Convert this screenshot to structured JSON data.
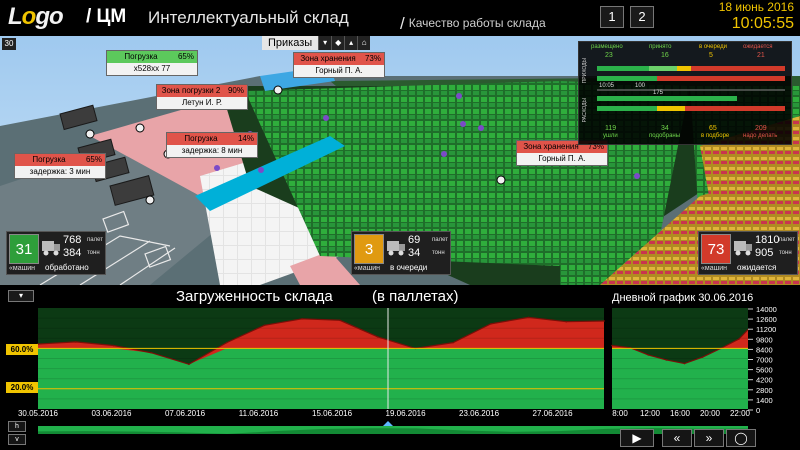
{
  "header": {
    "logo_text_left": "L",
    "logo_text_o": "o",
    "logo_text_right": "go",
    "app_title": "/ ЦМ",
    "title": "Интеллектуальный склад",
    "subtitle_slash": "/",
    "subtitle": "Качество работы склада",
    "pages": [
      "1",
      "2"
    ],
    "date": "18 июнь 2016",
    "time": "10:05:55"
  },
  "scene": {
    "fps": "30",
    "orders_label": "Приказы",
    "orders_buttons": [
      "▾",
      "◆",
      "▴",
      "⌂"
    ],
    "tags": [
      {
        "title": "Погрузка",
        "value": "65%",
        "line": "x528xx 77",
        "color": "green"
      },
      {
        "title": "Зона погрузки 2",
        "value": "90%",
        "line": "Летун И. Р.",
        "color": "red"
      },
      {
        "title": "Погрузка",
        "value": "14%",
        "line": "задержка: 8 мин",
        "color": "red"
      },
      {
        "title": "Погрузка",
        "value": "65%",
        "line": "задержка: 3 мин",
        "color": "red"
      },
      {
        "title": "Зона хранения",
        "value": "73%",
        "line": "Горный П. А.",
        "color": "red"
      },
      {
        "title": "Зона хранения",
        "value": "73%",
        "line": "Горный П. А.",
        "color": "red"
      }
    ],
    "stats": {
      "headers": [
        "размещено",
        "принято",
        "в очереди",
        "ожидается"
      ],
      "header_values": [
        "23",
        "16",
        "5",
        "21"
      ],
      "side_labels": [
        "ПРИХОДЫ",
        "РАСХОДЫ"
      ],
      "times": [
        "10:05",
        "100"
      ],
      "mid_value": "175",
      "bottom_values": [
        "119",
        "34",
        "65",
        "209"
      ],
      "footer": [
        "ушли",
        "подобраны",
        "в подборе",
        "надо делать"
      ]
    },
    "kpis": [
      {
        "big": "31",
        "v1": "768",
        "u1": "палет",
        "v2": "384",
        "u2": "тонн",
        "cap1": "«машин",
        "cap2": "обработано",
        "color": "#2e9e3a"
      },
      {
        "big": "3",
        "v1": "69",
        "u1": "палет",
        "v2": "34",
        "u2": "тонн",
        "cap1": "«машин",
        "cap2": "в очереди",
        "color": "#e09a10"
      },
      {
        "big": "73",
        "v1": "1810",
        "u1": "палет",
        "v2": "905",
        "u2": "тонн",
        "cap1": "«машин",
        "cap2": "ожидается",
        "color": "#d23a2a"
      }
    ]
  },
  "chart": {
    "toggle": "▾",
    "title": "Загруженность склада",
    "title2": "(в паллетах)",
    "daily_label": "Дневной график 30.06.2016",
    "thresholds": [
      "60.0%",
      "20.0%"
    ],
    "colors": {
      "green": "#22b14c",
      "red": "#d0281c",
      "yellow": "#f0c400"
    }
  },
  "chart_data": [
    {
      "type": "area",
      "title": "Загруженность склада",
      "x_ticks": [
        "30.05.2016",
        "03.06.2016",
        "07.06.2016",
        "11.06.2016",
        "15.06.2016",
        "19.06.2016",
        "23.06.2016",
        "27.06.2016"
      ],
      "x": [
        0,
        2,
        4,
        6,
        8,
        10,
        12,
        14,
        16,
        18,
        20,
        22,
        24,
        26,
        28,
        30
      ],
      "values": [
        9000,
        9300,
        8800,
        7800,
        6200,
        9200,
        11600,
        12500,
        12300,
        10000,
        8400,
        9200,
        11800,
        12700,
        12100,
        12200
      ],
      "ylim": [
        0,
        14000
      ],
      "thresholds": [
        {
          "label": "60.0%",
          "value": 8400
        },
        {
          "label": "20.0%",
          "value": 2800
        }
      ]
    },
    {
      "type": "area",
      "title": "Дневной график 30.06.2016",
      "x_ticks": [
        "8:00",
        "12:00",
        "16:00",
        "20:00",
        "22:00"
      ],
      "x": [
        8,
        10,
        12,
        14,
        16,
        18,
        20,
        22,
        23
      ],
      "values": [
        8800,
        8500,
        7500,
        6800,
        6300,
        7200,
        8400,
        9700,
        11000
      ],
      "y_ticks": [
        "14000",
        "12600",
        "11200",
        "9800",
        "8400",
        "7000",
        "5600",
        "4200",
        "2800",
        "1400",
        "0"
      ],
      "ylim": [
        0,
        14000
      ]
    }
  ],
  "controls": {
    "h_label": "h",
    "v_label": "v",
    "buttons": [
      "▶",
      "«",
      "»",
      "◯"
    ]
  }
}
